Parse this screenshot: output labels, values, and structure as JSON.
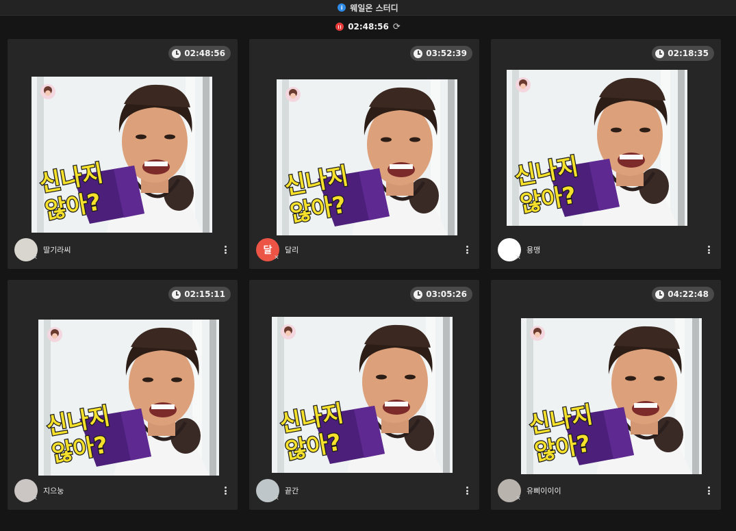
{
  "window": {
    "title": "웨일온 스터디"
  },
  "session": {
    "total_time": "02:48:56"
  },
  "participants": [
    {
      "name": "딸기라씨",
      "time": "02:48:56",
      "avatar_color": "#d9d6cf",
      "avatar_text": ""
    },
    {
      "name": "달리",
      "time": "03:52:39",
      "avatar_color": "#ec5446",
      "avatar_text": "달"
    },
    {
      "name": "용맹",
      "time": "02:18:35",
      "avatar_color": "#ffffff",
      "avatar_text": ""
    },
    {
      "name": "지으눙",
      "time": "02:15:11",
      "avatar_color": "#cbc6c4",
      "avatar_text": ""
    },
    {
      "name": "끝간",
      "time": "03:05:26",
      "avatar_color": "#bfc6c9",
      "avatar_text": ""
    },
    {
      "name": "유삐이이이",
      "time": "04:22:48",
      "avatar_color": "#b9b3ad",
      "avatar_text": ""
    }
  ],
  "video": {
    "caption_line1": "신나지",
    "caption_line2": "않아?"
  },
  "colors": {
    "background": "#151515",
    "card": "#262626",
    "timer_pill": "#4a4a4a",
    "record": "#e53b3b",
    "app_icon": "#2f8be6"
  },
  "icons": {
    "app": "whale-on-icon",
    "record": "pause-record-icon",
    "refresh": "refresh-icon",
    "timer": "clock-icon",
    "menu": "more-vertical-icon",
    "mic": "mic-off-icon"
  }
}
